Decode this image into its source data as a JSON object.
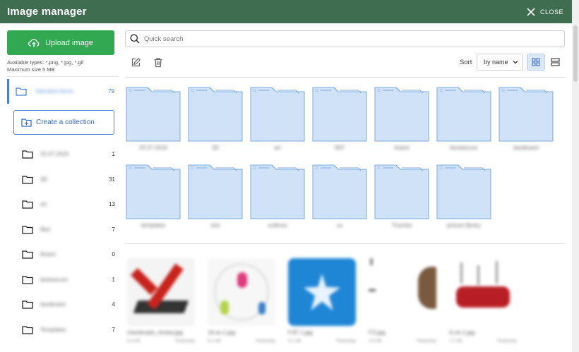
{
  "header": {
    "title": "Image manager",
    "close_label": "CLOSE"
  },
  "sidebar": {
    "upload_label": "Upload image",
    "hint_types": "Available types: *.png, *.jpg, *.gif",
    "hint_size": "Maximum size 5 MB",
    "active_collection": {
      "label": "Standard Items",
      "count": "79"
    },
    "create_label": "Create a collection",
    "collections": [
      {
        "label": "25.07.2019",
        "count": "1"
      },
      {
        "label": "3D",
        "count": "31"
      },
      {
        "label": "art",
        "count": "13"
      },
      {
        "label": "Bkd",
        "count": "7"
      },
      {
        "label": "Board",
        "count": "0"
      },
      {
        "label": "bestsecure",
        "count": "1"
      },
      {
        "label": "bestboard",
        "count": "4"
      },
      {
        "label": "Templates",
        "count": "7"
      }
    ]
  },
  "search": {
    "placeholder": "Quick search"
  },
  "sort": {
    "label": "Sort",
    "value": "by name"
  },
  "folders": [
    {
      "label": "25.07.2019"
    },
    {
      "label": "3D"
    },
    {
      "label": "art"
    },
    {
      "label": "SEF"
    },
    {
      "label": "board"
    },
    {
      "label": "bestsecure"
    },
    {
      "label": "bestboard"
    },
    {
      "label": "templates"
    },
    {
      "label": "test"
    },
    {
      "label": "outlines"
    },
    {
      "label": "ux"
    },
    {
      "label": "Thumbs"
    },
    {
      "label": "picture library"
    }
  ],
  "images": [
    {
      "name": "checkmark_review.jpg",
      "size": "8.4 kB",
      "date": "Yesterday"
    },
    {
      "name": "16.ex.1.jpg",
      "size": "6.2 kB",
      "date": "Yesterday"
    },
    {
      "name": "F.87.1.jpg",
      "size": "5.1 kB",
      "date": "Yesterday"
    },
    {
      "name": "F.5.jpg",
      "size": "3.9 kB",
      "date": "Yesterday"
    },
    {
      "name": "A.rm.1.jpg",
      "size": "7.7 kB",
      "date": "Yesterday"
    },
    {
      "name": "14.ex.1.jpg",
      "size": "9.0 kB",
      "date": "Yesterday"
    }
  ],
  "colors": {
    "header": "#3e6d4f",
    "upload": "#33a852",
    "accent": "#4a7fd1",
    "folder_fill": "#cfe2f7",
    "folder_stroke": "#7fa9dc"
  }
}
